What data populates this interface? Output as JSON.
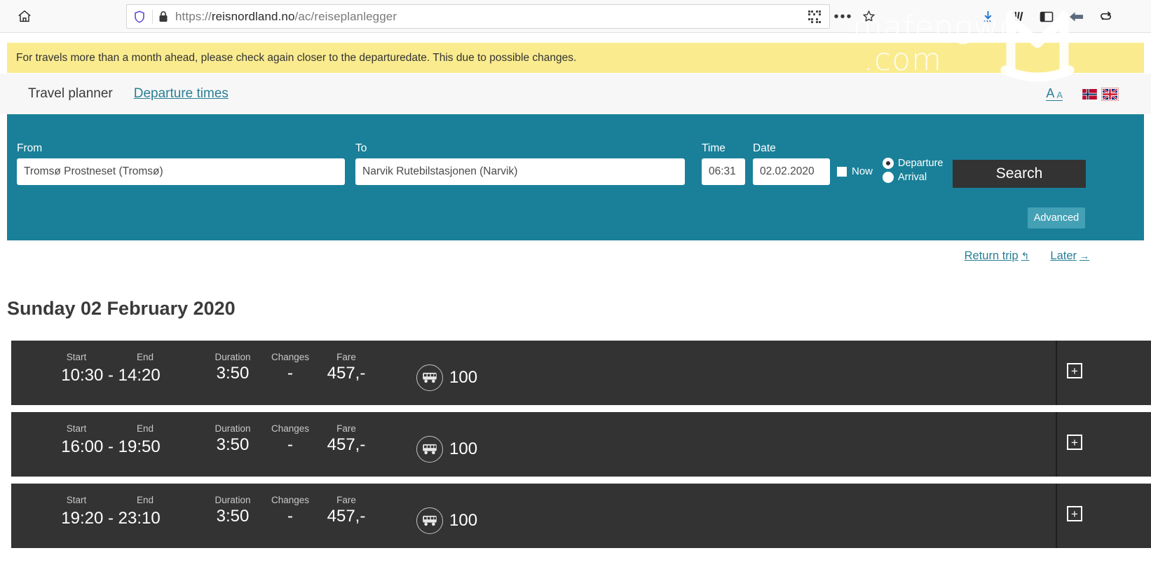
{
  "browser": {
    "url_prefix": "https://",
    "url_host": "reisnordland.no",
    "url_path": "/ac/reiseplanlegger",
    "icons": {
      "home": "home-icon",
      "shield": "shield-icon",
      "lock": "lock-icon",
      "qr": "qr-code-icon",
      "menu": "more-options-icon",
      "bookmark": "star-icon",
      "download": "download-arrow-icon",
      "library": "library-icon",
      "sidebar": "sidebar-icon",
      "back": "back-arrow-icon",
      "sync": "sync-icon"
    }
  },
  "watermark": {
    "line1": "mafengwo",
    "line2": ".com"
  },
  "notice": {
    "text": "For travels more than a month ahead, please check again closer to the departuredate. This due to possible changes."
  },
  "tabs": {
    "active": "Travel planner",
    "link": "Departure times",
    "font_size_large": "A",
    "font_size_small": "A",
    "flag_no": "norwegian-flag",
    "flag_en": "uk-flag"
  },
  "search": {
    "from_label": "From",
    "from_value": "Tromsø Prostneset (Tromsø)",
    "to_label": "To",
    "to_value": "Narvik Rutebilstasjonen (Narvik)",
    "time_label": "Time",
    "time_value": "06:31",
    "date_label": "Date",
    "date_value": "02.02.2020",
    "now_label": "Now",
    "now_checked": false,
    "departure_label": "Departure",
    "arrival_label": "Arrival",
    "selected_mode": "Departure",
    "search_button": "Search",
    "advanced_button": "Advanced",
    "accent_color": "#1a8099",
    "button_color": "#333333"
  },
  "sublinks": {
    "return_trip": "Return trip",
    "return_arrow": "↰",
    "later": "Later",
    "later_arrow": "→"
  },
  "results": {
    "day_heading": "Sunday 02 February 2020",
    "columns": {
      "start": "Start",
      "end": "End",
      "duration": "Duration",
      "changes": "Changes",
      "fare": "Fare"
    },
    "rows": [
      {
        "start": "10:30",
        "end": "14:20",
        "time_range": "10:30 - 14:20",
        "duration": "3:50",
        "changes": "-",
        "fare": "457,-",
        "route": "100",
        "transport_icon": "bus-icon",
        "expand": "+"
      },
      {
        "start": "16:00",
        "end": "19:50",
        "time_range": "16:00 - 19:50",
        "duration": "3:50",
        "changes": "-",
        "fare": "457,-",
        "route": "100",
        "transport_icon": "bus-icon",
        "expand": "+"
      },
      {
        "start": "19:20",
        "end": "23:10",
        "time_range": "19:20 - 23:10",
        "duration": "3:50",
        "changes": "-",
        "fare": "457,-",
        "route": "100",
        "transport_icon": "bus-icon",
        "expand": "+"
      }
    ]
  }
}
